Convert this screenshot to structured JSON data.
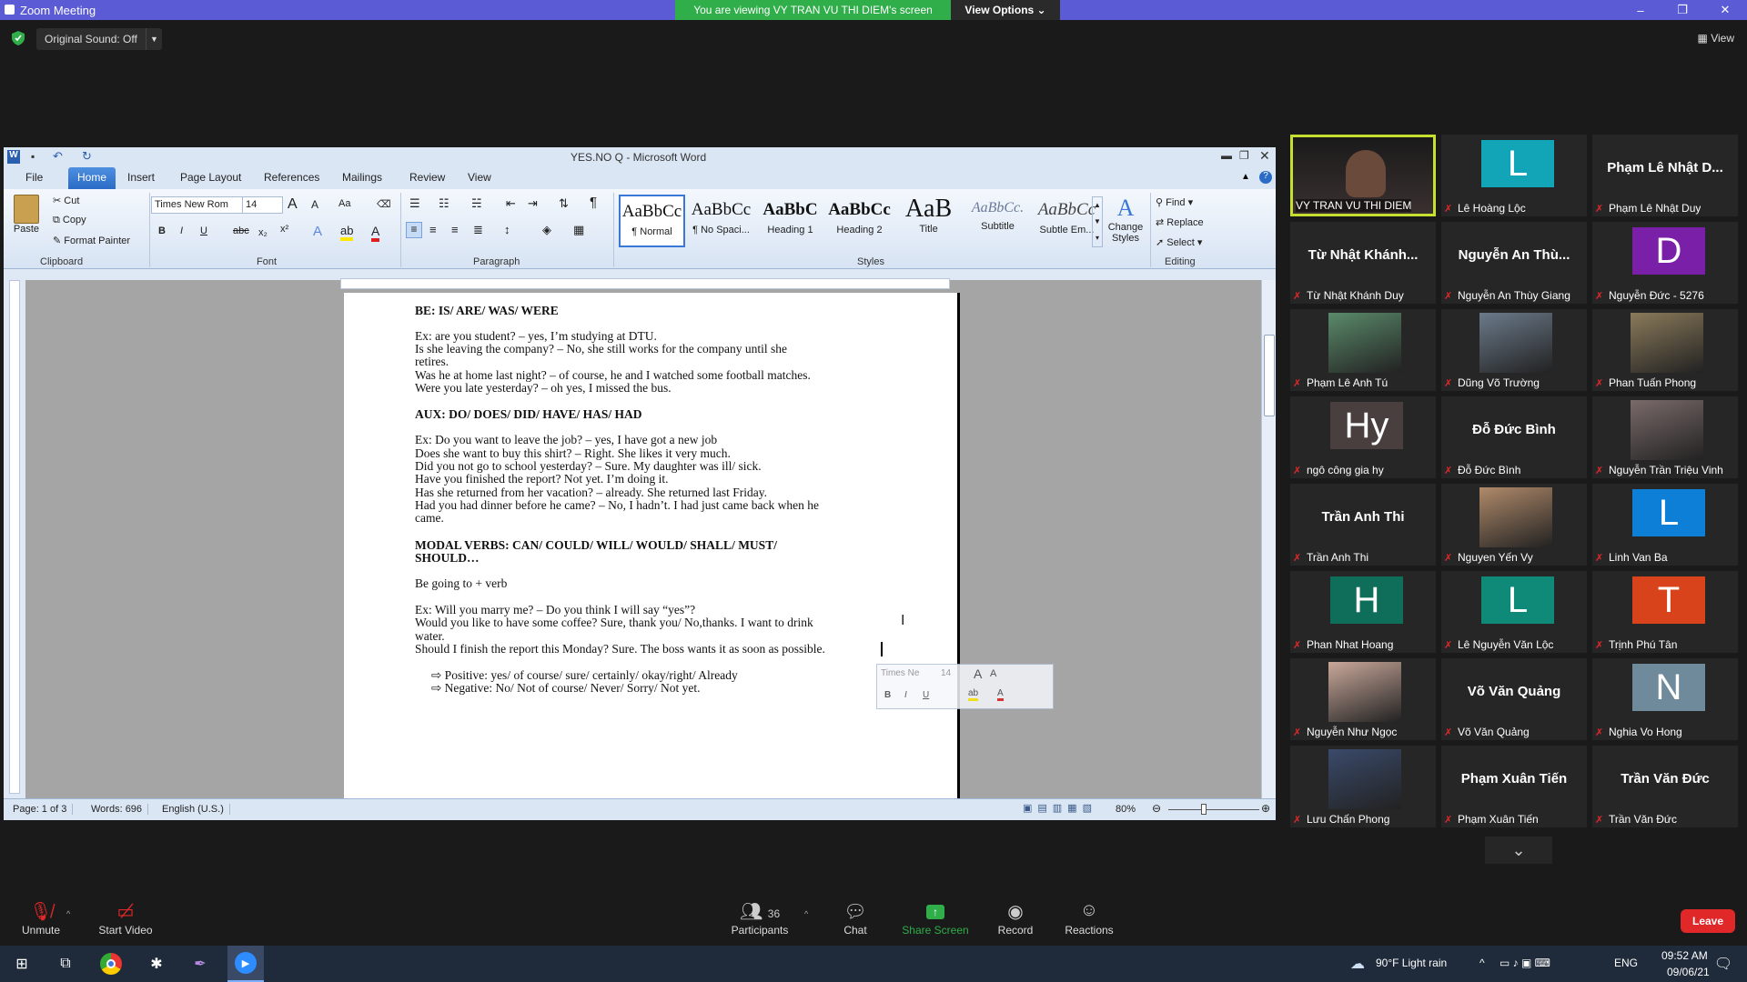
{
  "zoom": {
    "window_title": "Zoom Meeting",
    "viewing_banner": "You are viewing VY TRAN VU THI DIEM's screen",
    "view_options": "View Options",
    "original_sound": "Original Sound: Off",
    "view_label": "View"
  },
  "word": {
    "title": "YES.NO Q - Microsoft Word",
    "tabs": [
      "File",
      "Home",
      "Insert",
      "Page Layout",
      "References",
      "Mailings",
      "Review",
      "View"
    ],
    "clipboard": {
      "paste": "Paste",
      "cut": "Cut",
      "copy": "Copy",
      "format_painter": "Format Painter",
      "group": "Clipboard"
    },
    "font": {
      "name": "Times New Rom",
      "size": "14",
      "group": "Font"
    },
    "paragraph_group": "Paragraph",
    "styles": [
      {
        "preview": "AaBbCc",
        "name": "¶ Normal"
      },
      {
        "preview": "AaBbCc",
        "name": "¶ No Spaci..."
      },
      {
        "preview": "AaBbC",
        "name": "Heading 1"
      },
      {
        "preview": "AaBbCc",
        "name": "Heading 2"
      },
      {
        "preview": "AaB",
        "name": "Title"
      },
      {
        "preview": "AaBbCc.",
        "name": "Subtitle"
      },
      {
        "preview": "AaBbCc",
        "name": "Subtle Em..."
      }
    ],
    "styles_group": "Styles",
    "change_styles": "Change Styles",
    "editing": {
      "find": "Find",
      "replace": "Replace",
      "select": "Select",
      "group": "Editing"
    },
    "document_lines": [
      {
        "text": "BE: IS/ ARE/ WAS/ WERE",
        "bold": true
      },
      {
        "text": "Ex:              are you student? – yes, I’m studying at DTU.",
        "bold": false
      },
      {
        "text": " Is she leaving the company?  – No, she still works for the company until she",
        "bold": false
      },
      {
        "text": "retires.",
        "bold": false
      },
      {
        "text": "Was he at home last night? – of course, he and I watched some football matches.",
        "bold": false
      },
      {
        "text": "Were you late yesterday? – oh yes, I missed the bus.",
        "bold": false
      },
      {
        "text": "AUX: DO/ DOES/ DID/ HAVE/ HAS/ HAD",
        "bold": true
      },
      {
        "text": "Ex: Do you want to leave the job? – yes, I have got a new job",
        "bold": false
      },
      {
        "text": "Does she want to buy this shirt? – Right. She likes it very much.",
        "bold": false
      },
      {
        "text": "Did you not go to school yesterday? – Sure. My daughter was ill/ sick.",
        "bold": false
      },
      {
        "text": "Have you finished the report?  Not yet. I’m doing it.",
        "bold": false
      },
      {
        "text": "Has she returned from her vacation? – already. She returned last Friday.",
        "bold": false
      },
      {
        "text": "Had you had dinner before he came? – No, I hadn’t. I had just came back when he",
        "bold": false
      },
      {
        "text": "came.",
        "bold": false
      },
      {
        "text": "MODAL VERBS: CAN/ COULD/ WILL/ WOULD/ SHALL/ MUST/",
        "bold": true
      },
      {
        "text": "SHOULD…",
        "bold": true
      },
      {
        "text": "Be going to + verb",
        "bold": false
      },
      {
        "text": "Ex: Will you marry me? – Do you think I will say “yes”?",
        "bold": false
      },
      {
        "text": "Would you like to have some coffee? Sure, thank you/ No,thanks. I want to drink",
        "bold": false
      },
      {
        "text": "water.",
        "bold": false
      },
      {
        "text": "Should I finish the report this Monday? Sure. The boss wants it as soon as possible.",
        "bold": false
      },
      {
        "text": "⇨  Positive: yes/ of course/ sure/ certainly/ okay/right/ Already",
        "bold": false
      },
      {
        "text": "⇨  Negative: No/ Not of course/ Never/ Sorry/ Not yet.",
        "bold": false
      }
    ],
    "status": {
      "page": "Page: 1 of 3",
      "words": "Words: 696",
      "language": "English (U.S.)",
      "zoom": "80%"
    },
    "mini_toolbar_font": "Times Ne",
    "mini_toolbar_size": "14"
  },
  "participants": [
    {
      "name": "VY TRAN VU THI DIEM",
      "type": "video",
      "speaker": true
    },
    {
      "name": "Lê Hoàng Lộc",
      "type": "letter",
      "letter": "L",
      "color": "#12a5b8"
    },
    {
      "name": "Phạm Lê Nhật Duy",
      "type": "text",
      "big": "Phạm Lê Nhật D..."
    },
    {
      "name": "Từ Nhật Khánh Duy",
      "type": "text",
      "big": "Từ Nhật Khánh..."
    },
    {
      "name": "Nguyễn An Thùy Giang",
      "type": "text",
      "big": "Nguyễn An Thù..."
    },
    {
      "name": "Nguyễn Đức - 5276",
      "type": "letter",
      "letter": "D",
      "color": "#7a1fa8"
    },
    {
      "name": "Phạm Lê Anh Tú",
      "type": "photo",
      "color": "#5a8a6a"
    },
    {
      "name": "Dũng Võ Trường",
      "type": "photo",
      "color": "#6b7a8a"
    },
    {
      "name": "Phan Tuấn Phong",
      "type": "photo",
      "color": "#8a7a5a"
    },
    {
      "name": "ngô công gia hy",
      "type": "letter",
      "letter": "Hy",
      "color": "#4a3f3f"
    },
    {
      "name": "Đỗ Đức Bình",
      "type": "text",
      "big": "Đỗ Đức Bình"
    },
    {
      "name": "Nguyễn Trần Triệu Vinh",
      "type": "photo",
      "color": "#7a6a6a"
    },
    {
      "name": "Trần Anh Thi",
      "type": "text",
      "big": "Trần Anh Thi"
    },
    {
      "name": "Nguyen Yến Vy",
      "type": "photo",
      "color": "#b08a6a"
    },
    {
      "name": "Linh Van Ba",
      "type": "letter",
      "letter": "L",
      "color": "#0e7fd6"
    },
    {
      "name": "Phan Nhat Hoang",
      "type": "letter",
      "letter": "H",
      "color": "#0e6e5a"
    },
    {
      "name": "Lê Nguyễn Văn Lộc",
      "type": "letter",
      "letter": "L",
      "color": "#0f8a78"
    },
    {
      "name": "Trịnh Phú Tân",
      "type": "letter",
      "letter": "T",
      "color": "#d8431b"
    },
    {
      "name": "Nguyễn Như Ngọc",
      "type": "photo",
      "color": "#c9a89a"
    },
    {
      "name": "Võ Văn Quảng",
      "type": "text",
      "big": "Võ Văn Quảng"
    },
    {
      "name": "Nghia Vo Hong",
      "type": "letter",
      "letter": "N",
      "color": "#6f8a9a"
    },
    {
      "name": "Lưu Chấn Phong",
      "type": "photo",
      "color": "#3a4a6a"
    },
    {
      "name": "Phạm Xuân Tiến",
      "type": "text",
      "big": "Phạm Xuân Tiến"
    },
    {
      "name": "Trần Văn Đức",
      "type": "text",
      "big": "Trần Văn Đức"
    }
  ],
  "toolbar": {
    "unmute": "Unmute",
    "start_video": "Start Video",
    "participants": "Participants",
    "participant_count": "36",
    "chat": "Chat",
    "share_screen": "Share Screen",
    "record": "Record",
    "reactions": "Reactions",
    "leave": "Leave"
  },
  "taskbar": {
    "weather": "90°F  Light rain",
    "lang": "ENG",
    "time": "09:52 AM",
    "date": "09/06/21"
  },
  "colors": {
    "zoom_title": "#5b5bd6",
    "banner_green": "#2fae4a",
    "leave_red": "#e02828",
    "speaker_border": "#c7df2f"
  }
}
